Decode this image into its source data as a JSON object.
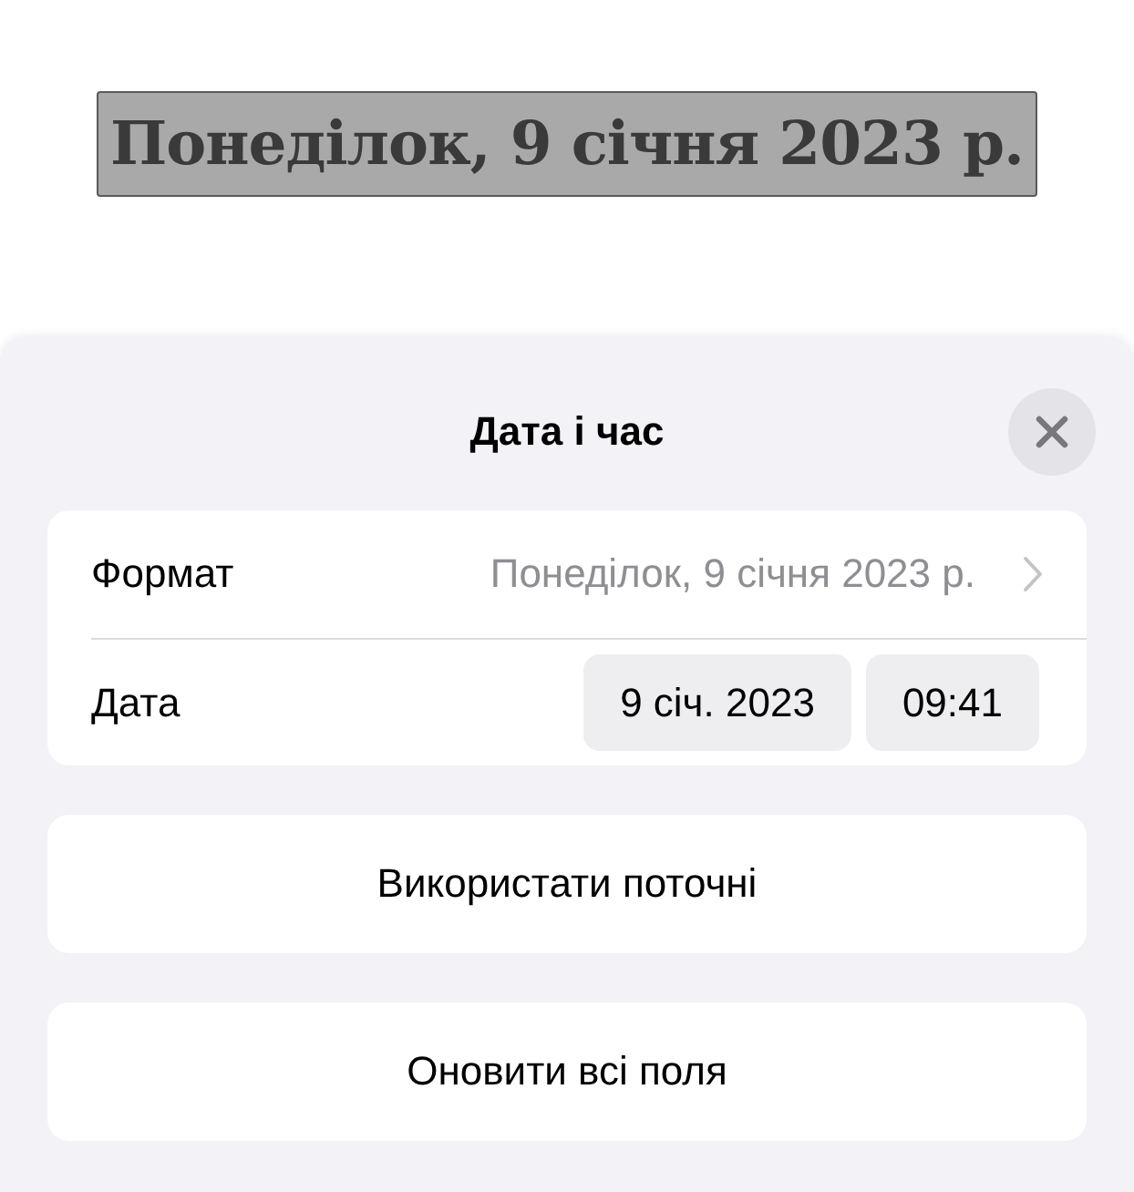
{
  "document": {
    "text": "Понеділок, 9 січня 2023 р.",
    "selected": true
  },
  "sheet": {
    "title": "Дата і час",
    "rows": [
      {
        "kind": "link",
        "label": "Формат",
        "value": "Понеділок, 9 січня 2023 р."
      },
      {
        "kind": "pickers",
        "label": "Дата",
        "pickers": [
          "9 січ. 2023",
          "09:41"
        ]
      }
    ],
    "buttons": [
      "Використати поточні",
      "Оновити всі поля"
    ]
  }
}
